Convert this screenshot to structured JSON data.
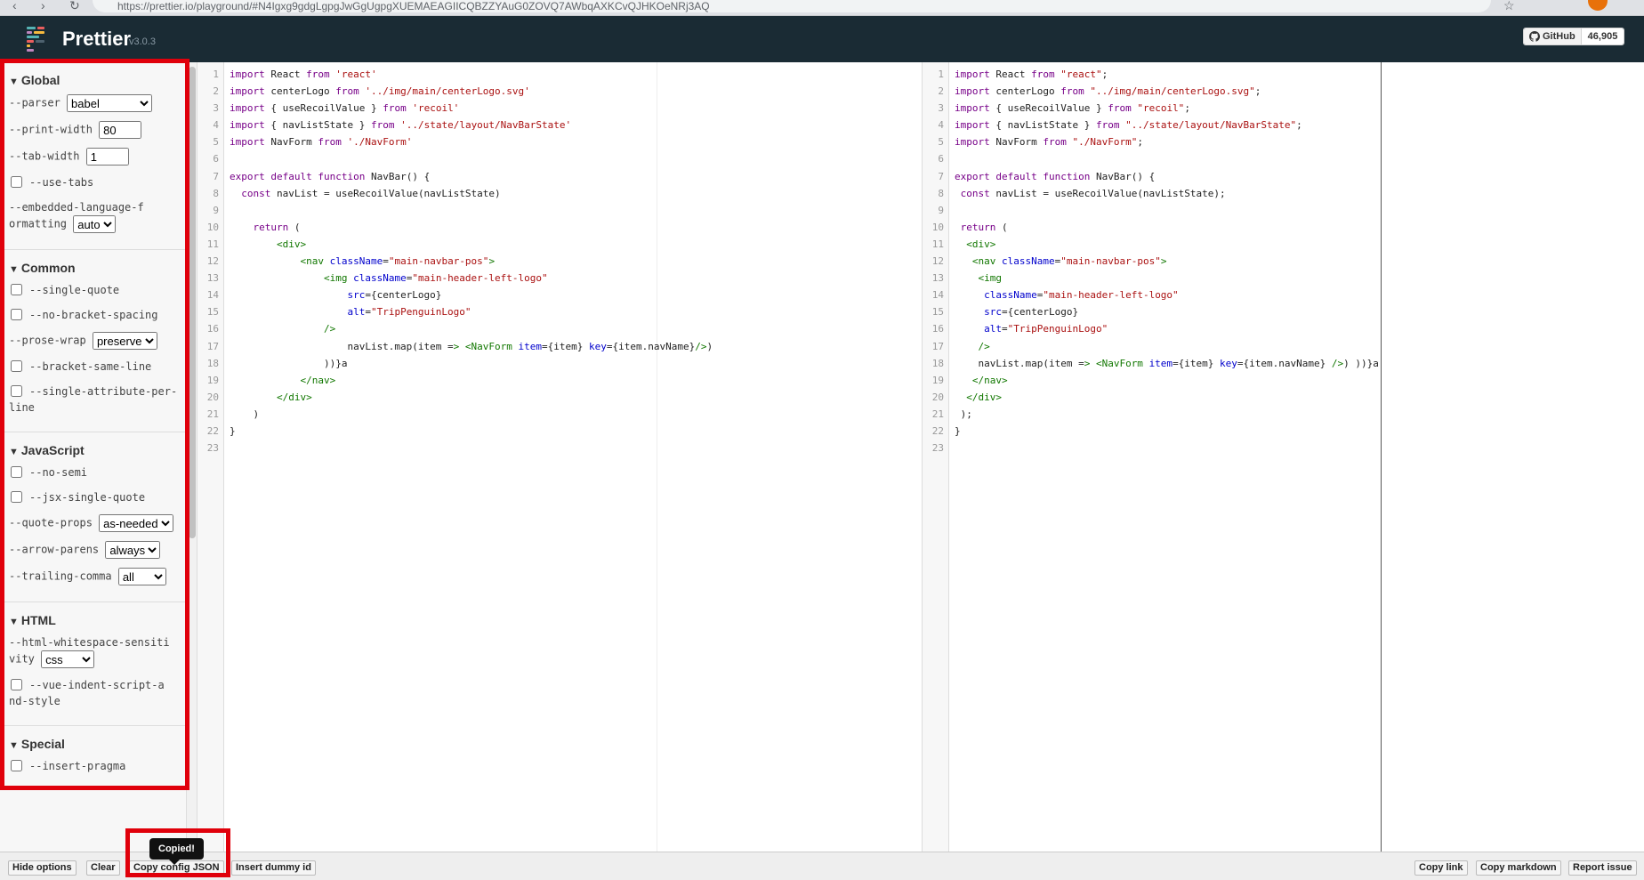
{
  "browser": {
    "url": "https://prettier.io/playground/#N4Igxg9gdgLgpgJwGgUgpgXUEMAEAGIICQBZZYAuG0ZOVQ7AWbqAXKCvQJHKOeNRj3AQ"
  },
  "header": {
    "brand": "Prettier",
    "version": "v3.0.3",
    "github_label": "GitHub",
    "github_stars": "46,905"
  },
  "options": {
    "global": {
      "title": "Global",
      "parser_label": "--parser",
      "parser_value": "babel",
      "print_width_label": "--print-width",
      "print_width_value": "80",
      "tab_width_label": "--tab-width",
      "tab_width_value": "1",
      "use_tabs_label": "--use-tabs",
      "embedded_label": "--embedded-language-formatting",
      "embedded_value": "auto"
    },
    "common": {
      "title": "Common",
      "single_quote_label": "--single-quote",
      "no_bracket_spacing_label": "--no-bracket-spacing",
      "prose_wrap_label": "--prose-wrap",
      "prose_wrap_value": "preserve",
      "bracket_same_line_label": "--bracket-same-line",
      "single_attr_label": "--single-attribute-per-line"
    },
    "javascript": {
      "title": "JavaScript",
      "no_semi_label": "--no-semi",
      "jsx_single_quote_label": "--jsx-single-quote",
      "quote_props_label": "--quote-props",
      "quote_props_value": "as-needed",
      "arrow_parens_label": "--arrow-parens",
      "arrow_parens_value": "always",
      "trailing_comma_label": "--trailing-comma",
      "trailing_comma_value": "all"
    },
    "html": {
      "title": "HTML",
      "whitespace_label": "--html-whitespace-sensitivity",
      "whitespace_value": "css",
      "vue_indent_label": "--vue-indent-script-and-style"
    },
    "special": {
      "title": "Special",
      "insert_pragma_label": "--insert-pragma"
    }
  },
  "input_lines": [
    {
      "n": "1",
      "code": "import React from 'react'"
    },
    {
      "n": "2",
      "code": "import centerLogo from '../img/main/centerLogo.svg'"
    },
    {
      "n": "3",
      "code": "import { useRecoilValue } from 'recoil'"
    },
    {
      "n": "4",
      "code": "import { navListState } from '../state/layout/NavBarState'"
    },
    {
      "n": "5",
      "code": "import NavForm from './NavForm'"
    },
    {
      "n": "6",
      "code": ""
    },
    {
      "n": "7",
      "code": "export default function NavBar() {"
    },
    {
      "n": "8",
      "code": "  const navList = useRecoilValue(navListState)"
    },
    {
      "n": "9",
      "code": ""
    },
    {
      "n": "10",
      "code": "    return ("
    },
    {
      "n": "11",
      "code": "        <div>"
    },
    {
      "n": "12",
      "code": "            <nav className=\"main-navbar-pos\">"
    },
    {
      "n": "13",
      "code": "                <img className=\"main-header-left-logo\""
    },
    {
      "n": "14",
      "code": "                    src={centerLogo}"
    },
    {
      "n": "15",
      "code": "                    alt=\"TripPenguinLogo\""
    },
    {
      "n": "16",
      "code": "                />"
    },
    {
      "n": "17",
      "code": "                    navList.map(item => <NavForm item={item} key={item.navName}/>)"
    },
    {
      "n": "18",
      "code": "                ))}a"
    },
    {
      "n": "19",
      "code": "            </nav>"
    },
    {
      "n": "20",
      "code": "        </div>"
    },
    {
      "n": "21",
      "code": "    )"
    },
    {
      "n": "22",
      "code": "}"
    },
    {
      "n": "23",
      "code": ""
    }
  ],
  "output_lines": [
    {
      "n": "1",
      "code": "import React from \"react\";"
    },
    {
      "n": "2",
      "code": "import centerLogo from \"../img/main/centerLogo.svg\";"
    },
    {
      "n": "3",
      "code": "import { useRecoilValue } from \"recoil\";"
    },
    {
      "n": "4",
      "code": "import { navListState } from \"../state/layout/NavBarState\";"
    },
    {
      "n": "5",
      "code": "import NavForm from \"./NavForm\";"
    },
    {
      "n": "6",
      "code": ""
    },
    {
      "n": "7",
      "code": "export default function NavBar() {"
    },
    {
      "n": "8",
      "code": " const navList = useRecoilValue(navListState);"
    },
    {
      "n": "9",
      "code": ""
    },
    {
      "n": "10",
      "code": " return ("
    },
    {
      "n": "11",
      "code": "  <div>"
    },
    {
      "n": "12",
      "code": "   <nav className=\"main-navbar-pos\">"
    },
    {
      "n": "13",
      "code": "    <img"
    },
    {
      "n": "14",
      "code": "     className=\"main-header-left-logo\""
    },
    {
      "n": "15",
      "code": "     src={centerLogo}"
    },
    {
      "n": "16",
      "code": "     alt=\"TripPenguinLogo\""
    },
    {
      "n": "17",
      "code": "    />"
    },
    {
      "n": "18",
      "code": "    navList.map(item => <NavForm item={item} key={item.navName} />) ))}a"
    },
    {
      "n": "19",
      "code": "   </nav>"
    },
    {
      "n": "20",
      "code": "  </div>"
    },
    {
      "n": "21",
      "code": " );"
    },
    {
      "n": "22",
      "code": "}"
    },
    {
      "n": "23",
      "code": ""
    }
  ],
  "bottom_bar": {
    "hide_options": "Hide options",
    "clear": "Clear",
    "copy_config": "Copy config JSON",
    "insert_dummy": "Insert dummy id",
    "copy_link": "Copy link",
    "copy_markdown": "Copy markdown",
    "report_issue": "Report issue",
    "tooltip": "Copied!"
  },
  "colors": {
    "header_bg": "#1a2b34",
    "highlight": "#e0000b",
    "keyword": "#770088",
    "string": "#aa1111",
    "tag": "#117700",
    "attr": "#0000cc"
  }
}
